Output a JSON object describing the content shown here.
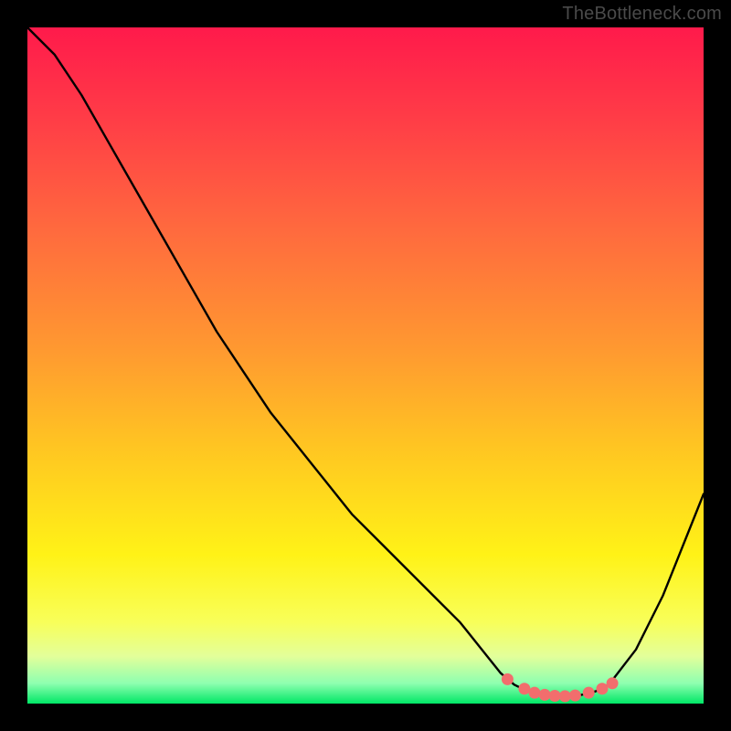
{
  "watermark": "TheBottleneck.com",
  "colors": {
    "curve": "#000000",
    "marker_fill": "#f26d6d",
    "marker_stroke": "#c94b4b",
    "background_black": "#000000"
  },
  "chart_data": {
    "type": "line",
    "title": "",
    "xlabel": "",
    "ylabel": "",
    "xlim": [
      0,
      100
    ],
    "ylim": [
      0,
      100
    ],
    "x": [
      0,
      4,
      8,
      12,
      16,
      20,
      24,
      28,
      32,
      36,
      40,
      44,
      48,
      52,
      56,
      60,
      64,
      68,
      70,
      72,
      74,
      76,
      78,
      80,
      82,
      84,
      86,
      90,
      94,
      100
    ],
    "y": [
      100,
      96,
      90,
      83,
      76,
      69,
      62,
      55,
      49,
      43,
      38,
      33,
      28,
      24,
      20,
      16,
      12,
      7,
      4.5,
      2.8,
      1.8,
      1.3,
      1.1,
      1.1,
      1.3,
      1.8,
      2.8,
      8,
      16,
      31
    ],
    "valley_markers_x": [
      71,
      73.5,
      75,
      76.5,
      78,
      79.5,
      81,
      83,
      85,
      86.5
    ],
    "valley_markers_y": [
      3.6,
      2.2,
      1.6,
      1.3,
      1.15,
      1.1,
      1.2,
      1.6,
      2.2,
      3.0
    ],
    "marker_radius_px": 6.5
  }
}
